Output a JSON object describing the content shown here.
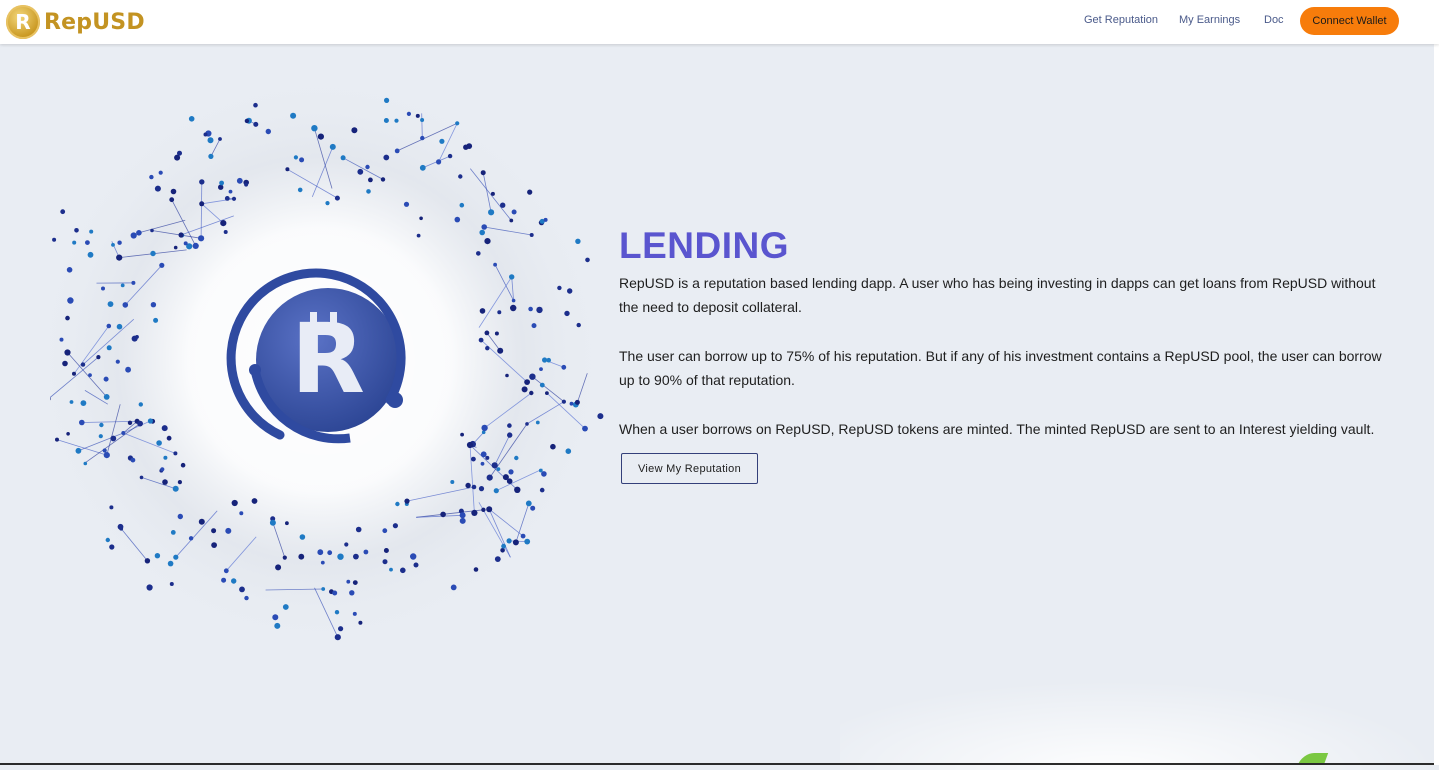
{
  "brand": {
    "logo_letter": "R",
    "name": "RepUSD",
    "gold": "#c39322"
  },
  "nav": {
    "links": [
      "Get Reputation",
      "My Earnings",
      "Doc"
    ],
    "connect_label": "Connect Wallet",
    "accent": "#f77c0b"
  },
  "hero": {
    "icon": "repusd-coin-icon",
    "network_color": "#3a4fb5"
  },
  "section": {
    "title": "LENDING",
    "title_color": "#5a55cf",
    "paragraphs": [
      "RepUSD is a reputation based lending dapp. A user who has being investing in dapps can get loans from RepUSD without the need to deposit collateral.",
      "The user can borrow up to 75% of his reputation. But if any of his investment contains a RepUSD pool, the user can borrow up to 90% of that reputation.",
      "When a user borrows on RepUSD, RepUSD tokens are minted. The minted RepUSD are sent to an Interest yielding vault."
    ],
    "button_label": "View My Reputation"
  }
}
